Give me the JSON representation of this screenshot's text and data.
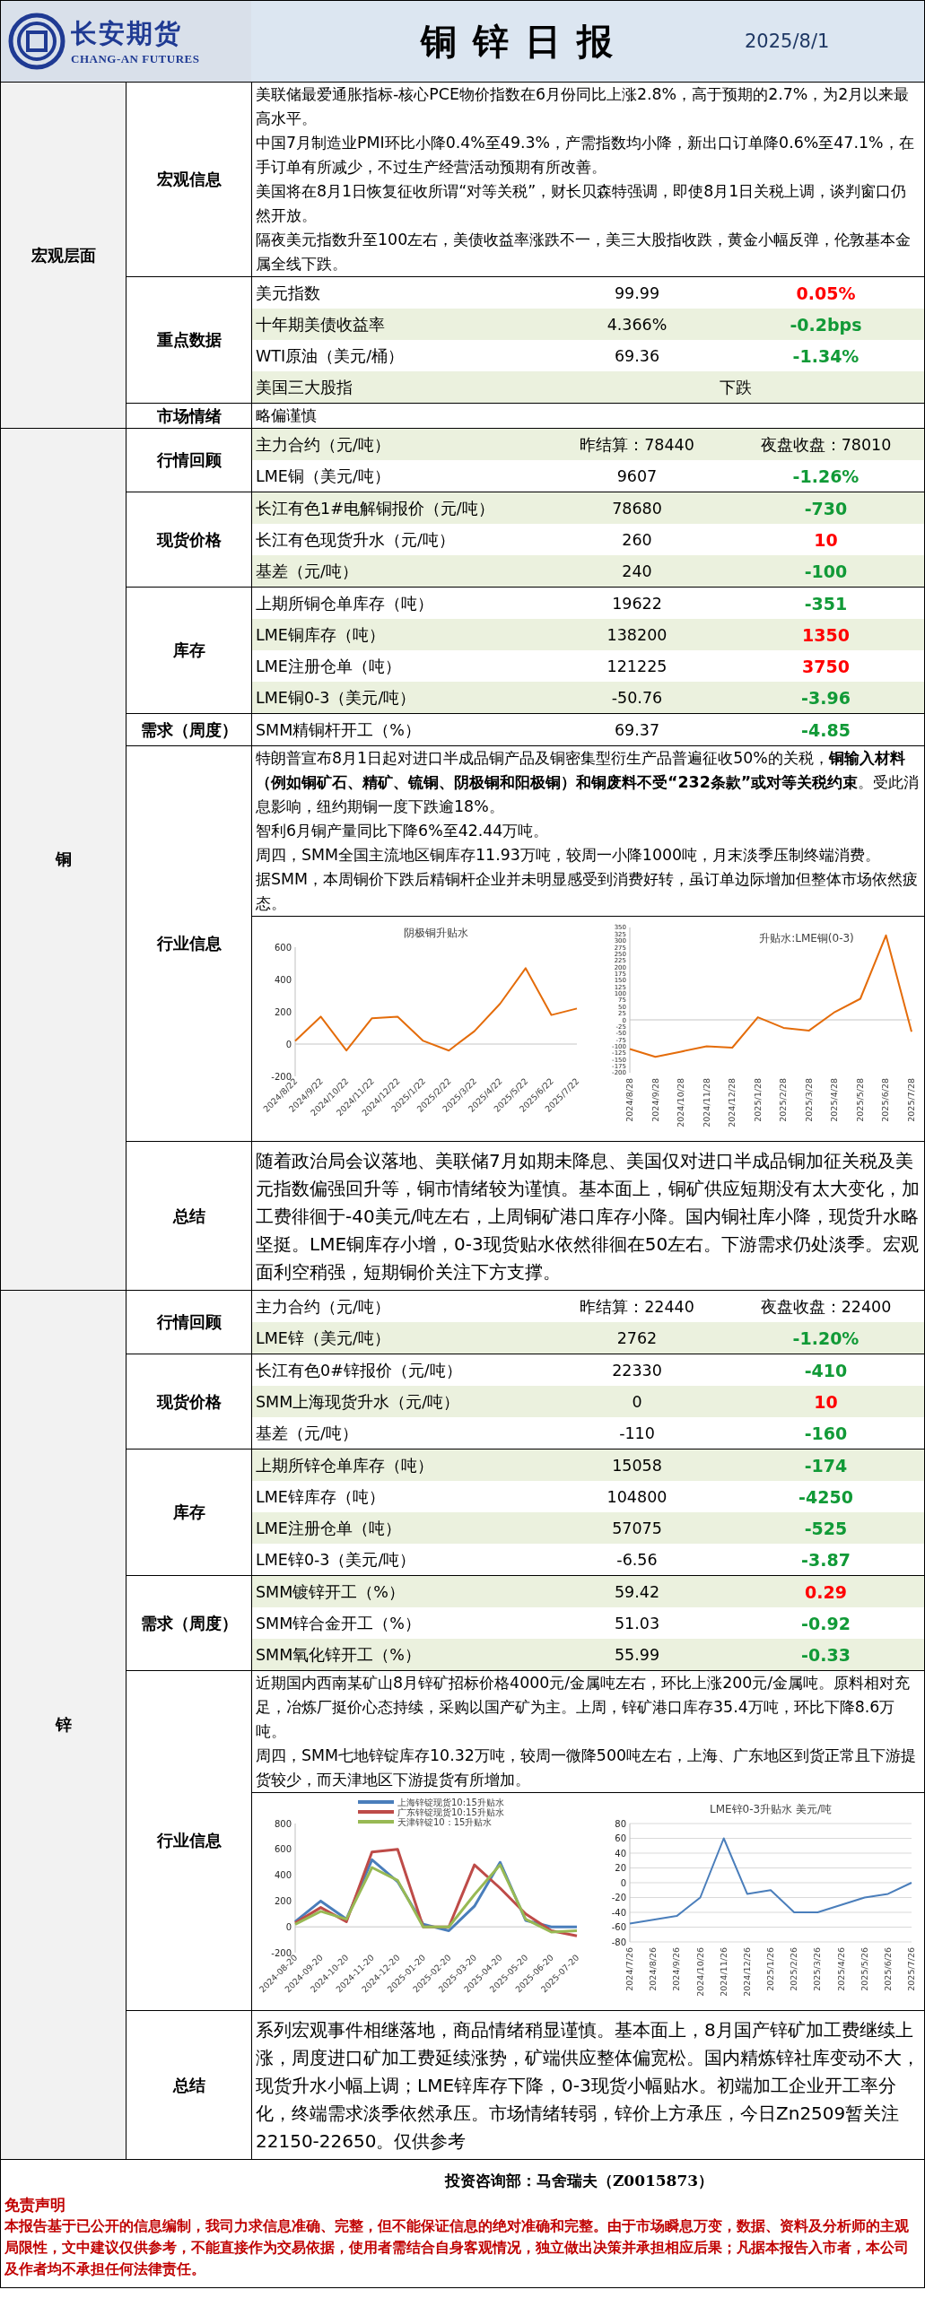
{
  "header": {
    "company": "长安期货",
    "company_en": "CHANG-AN FUTURES",
    "title": "铜锌日报",
    "date": "2025/8/1"
  },
  "sections": [
    {
      "label": "宏观层面",
      "blocks": [
        {
          "label": "宏观信息",
          "kind": "text",
          "paragraphs": [
            "美联储最爱通胀指标-核心PCE物价指数在6月份同比上涨2.8%，高于预期的2.7%，为2月以来最高水平。",
            "中国7月制造业PMI环比小降0.4%至49.3%，产需指数均小降，新出口订单降0.6%至47.1%，在手订单有所减少，不过生产经营活动预期有所改善。",
            "美国将在8月1日恢复征收所谓“对等关税”，财长贝森特强调，即使8月1日关税上调，谈判窗口仍然开放。",
            "隔夜美元指数升至100左右，美债收益率涨跌不一，美三大股指收跌，黄金小幅反弹，伦敦基本金属全线下跌。"
          ]
        },
        {
          "label": "重点数据",
          "kind": "rows",
          "rows": [
            {
              "kind": "quote",
              "label": "美元指数",
              "value": "99.99",
              "change": "0.05%",
              "color": "#ff0000",
              "shaded": false
            },
            {
              "kind": "quote",
              "label": "十年期美债收益率",
              "value": "4.366%",
              "change": "-0.2bps",
              "color": "#119a37",
              "shaded": true
            },
            {
              "kind": "quote",
              "label": "WTI原油（美元/桶）",
              "value": "69.36",
              "change": "-1.34%",
              "color": "#119a37",
              "shaded": false
            },
            {
              "kind": "span",
              "label": "美国三大股指",
              "value": "下跌",
              "shaded": true
            }
          ]
        },
        {
          "label": "市场情绪",
          "kind": "text",
          "paragraphs": [
            "略偏谨慎"
          ]
        }
      ]
    },
    {
      "label": "铜",
      "blocks": [
        {
          "label": "行情回顾",
          "kind": "rows",
          "rows": [
            {
              "kind": "settle",
              "label": "主力合约（元/吨）",
              "prev": "昨结算：78440",
              "night": "夜盘收盘：78010",
              "shaded": true
            },
            {
              "kind": "quote",
              "label": "LME铜（美元/吨）",
              "value": "9607",
              "change": "-1.26%",
              "color": "#119a37",
              "shaded": false
            }
          ]
        },
        {
          "label": "现货价格",
          "kind": "rows",
          "rows": [
            {
              "kind": "quote",
              "label": "长江有色1#电解铜报价（元/吨）",
              "value": "78680",
              "change": "-730",
              "color": "#119a37",
              "shaded": true
            },
            {
              "kind": "quote",
              "label": "长江有色现货升水（元/吨）",
              "value": "260",
              "change": "10",
              "color": "#ff0000",
              "shaded": false
            },
            {
              "kind": "quote",
              "label": "基差（元/吨）",
              "value": "240",
              "change": "-100",
              "color": "#119a37",
              "shaded": true
            }
          ]
        },
        {
          "label": "库存",
          "kind": "rows",
          "rows": [
            {
              "kind": "quote",
              "label": "上期所铜仓单库存（吨）",
              "value": "19622",
              "change": "-351",
              "color": "#119a37",
              "shaded": false
            },
            {
              "kind": "quote",
              "label": "LME铜库存（吨）",
              "value": "138200",
              "change": "1350",
              "color": "#ff0000",
              "shaded": true
            },
            {
              "kind": "quote",
              "label": "LME注册仓单（吨）",
              "value": "121225",
              "change": "3750",
              "color": "#ff0000",
              "shaded": false
            },
            {
              "kind": "quote",
              "label": "LME铜0-3（美元/吨）",
              "value": "-50.76",
              "change": "-3.96",
              "color": "#119a37",
              "shaded": true
            }
          ]
        },
        {
          "label": "需求（周度）",
          "kind": "rows",
          "rows": [
            {
              "kind": "quote",
              "label": "SMM精铜杆开工（%）",
              "value": "69.37",
              "change": "-4.85",
              "color": "#119a37",
              "shaded": false
            }
          ]
        },
        {
          "label": "行业信息",
          "kind": "text",
          "paragraphs": [
            "特朗普宣布8月1日起对进口半成品铜产品及铜密集型衍生产品普遍征收50%的关税，**铜输入材料（例如铜矿石、精矿、锍铜、阴极铜和阳极铜）和铜废料不受“232条款”或对等关税约束**。受此消息影响，纽约期铜一度下跌逾18%。",
            "智利6月铜产量同比下降6%至42.44万吨。",
            "周四，SMM全国主流地区铜库存11.93万吨，较周一小降1000吨，月末淡季压制终端消费。",
            "据SMM，本周铜价下跌后精铜杆企业并未明显感受到消费好转，虽订单边际增加但整体市场依然疲态。"
          ],
          "charts": [
            {
              "chart_data": {
                "type": "line",
                "title": "阴极铜升贴水",
                "series": [
                  {
                    "color": "#e46c0a",
                    "values": [
                      20,
                      170,
                      -40,
                      160,
                      170,
                      20,
                      -40,
                      80,
                      250,
                      470,
                      180,
                      220
                    ]
                  }
                ],
                "ylim": [
                  -200,
                  600
                ],
                "yticks": [
                  -200,
                  0,
                  200,
                  400,
                  600
                ],
                "categories": [
                  "2024/8/22",
                  "2024/9/22",
                  "2024/10/22",
                  "2024/11/22",
                  "2024/12/22",
                  "2025/1/22",
                  "2025/2/22",
                  "2025/3/22",
                  "2025/4/22",
                  "2025/5/22",
                  "2025/6/22",
                  "2025/7/22"
                ]
              }
            },
            {
              "chart_data": {
                "type": "line",
                "title": "升贴水:LME铜(0-3)",
                "series": [
                  {
                    "color": "#e46c0a",
                    "values": [
                      -110,
                      -140,
                      -120,
                      -100,
                      -105,
                      10,
                      -30,
                      -40,
                      30,
                      80,
                      320,
                      -45
                    ]
                  }
                ],
                "ylim": [
                  -200,
                  350
                ],
                "yticks": [
                  -200,
                  -175,
                  -150,
                  -125,
                  -100,
                  -75,
                  -50,
                  -25,
                  0,
                  25,
                  50,
                  75,
                  100,
                  125,
                  150,
                  175,
                  200,
                  225,
                  250,
                  275,
                  300,
                  325,
                  350
                ],
                "categories": [
                  "2024/8/28",
                  "2024/9/28",
                  "2024/10/28",
                  "2024/11/28",
                  "2024/12/28",
                  "2025/1/28",
                  "2025/2/28",
                  "2025/3/28",
                  "2025/4/28",
                  "2025/5/28",
                  "2025/6/28",
                  "2025/7/28"
                ]
              }
            }
          ]
        },
        {
          "label": "总结",
          "kind": "summary",
          "paragraphs": [
            "随着政治局会议落地、美联储7月如期未降息、美国仅对进口半成品铜加征关税及美元指数偏强回升等，铜市情绪较为谨慎。基本面上，铜矿供应短期没有太大变化，加工费徘徊于-40美元/吨左右，上周铜矿港口库存小降。国内铜社库小降，现货升水略坚挺。LME铜库存小增，0-3现货贴水依然徘徊在50左右。下游需求仍处淡季。宏观面利空稍强，短期铜价关注下方支撑。"
          ]
        }
      ]
    },
    {
      "label": "锌",
      "blocks": [
        {
          "label": "行情回顾",
          "kind": "rows",
          "rows": [
            {
              "kind": "settle",
              "label": "主力合约（元/吨）",
              "prev": "昨结算：22440",
              "night": "夜盘收盘：22400",
              "shaded": false
            },
            {
              "kind": "quote",
              "label": "LME锌（美元/吨）",
              "value": "2762",
              "change": "-1.20%",
              "color": "#119a37",
              "shaded": true
            }
          ]
        },
        {
          "label": "现货价格",
          "kind": "rows",
          "rows": [
            {
              "kind": "quote",
              "label": "长江有色0#锌报价（元/吨）",
              "value": "22330",
              "change": "-410",
              "color": "#119a37",
              "shaded": false
            },
            {
              "kind": "quote",
              "label": "SMM上海现货升水（元/吨）",
              "value": "0",
              "change": "10",
              "color": "#ff0000",
              "shaded": true
            },
            {
              "kind": "quote",
              "label": "基差（元/吨）",
              "value": "-110",
              "change": "-160",
              "color": "#119a37",
              "shaded": false
            }
          ]
        },
        {
          "label": "库存",
          "kind": "rows",
          "rows": [
            {
              "kind": "quote",
              "label": "上期所锌仓单库存（吨）",
              "value": "15058",
              "change": "-174",
              "color": "#119a37",
              "shaded": true
            },
            {
              "kind": "quote",
              "label": "LME锌库存（吨）",
              "value": "104800",
              "change": "-4250",
              "color": "#119a37",
              "shaded": false
            },
            {
              "kind": "quote",
              "label": "LME注册仓单（吨）",
              "value": "57075",
              "change": "-525",
              "color": "#119a37",
              "shaded": true
            },
            {
              "kind": "quote",
              "label": "LME锌0-3（美元/吨）",
              "value": "-6.56",
              "change": "-3.87",
              "color": "#119a37",
              "shaded": false
            }
          ]
        },
        {
          "label": "需求（周度）",
          "kind": "rows",
          "rows": [
            {
              "kind": "quote",
              "label": "SMM镀锌开工（%）",
              "value": "59.42",
              "change": "0.29",
              "color": "#ff0000",
              "shaded": true
            },
            {
              "kind": "quote",
              "label": "SMM锌合金开工（%）",
              "value": "51.03",
              "change": "-0.92",
              "color": "#119a37",
              "shaded": false
            },
            {
              "kind": "quote",
              "label": "SMM氧化锌开工（%）",
              "value": "55.99",
              "change": "-0.33",
              "color": "#119a37",
              "shaded": true
            }
          ]
        },
        {
          "label": "行业信息",
          "kind": "text",
          "paragraphs": [
            "近期国内西南某矿山8月锌矿招标价格4000元/金属吨左右，环比上涨200元/金属吨。原料相对充足，冶炼厂挺价心态持续，采购以国产矿为主。上周，锌矿港口库存35.4万吨，环比下降8.6万吨。",
            "周四，SMM七地锌锭库存10.32万吨，较周一微降500吨左右，上海、广东地区到货正常且下游提货较少，而天津地区下游提货有所增加。"
          ],
          "charts": [
            {
              "chart_data": {
                "type": "line",
                "legend": "top",
                "series": [
                  {
                    "name": "上海锌锭现货10:15升贴水",
                    "color": "#4a7ebb",
                    "values": [
                      40,
                      200,
                      60,
                      520,
                      350,
                      20,
                      -30,
                      160,
                      500,
                      50,
                      0,
                      0
                    ]
                  },
                  {
                    "name": "广东锌锭现货10:15升贴水",
                    "color": "#be4b48",
                    "values": [
                      30,
                      150,
                      40,
                      580,
                      600,
                      0,
                      0,
                      480,
                      300,
                      100,
                      -30,
                      -70
                    ]
                  },
                  {
                    "name": "天津锌锭10：15升贴水",
                    "color": "#98b954",
                    "values": [
                      20,
                      120,
                      60,
                      460,
                      360,
                      0,
                      0,
                      250,
                      480,
                      60,
                      -40,
                      -30
                    ]
                  }
                ],
                "ylim": [
                  -200,
                  800
                ],
                "yticks": [
                  -200,
                  0,
                  200,
                  400,
                  600,
                  800
                ],
                "categories": [
                  "2024-08-20",
                  "2024-09-20",
                  "2024-10-20",
                  "2024-11-20",
                  "2024-12-20",
                  "2025-01-20",
                  "2025-02-20",
                  "2025-03-20",
                  "2025-04-20",
                  "2025-05-20",
                  "2025-06-20",
                  "2025-07-20"
                ]
              }
            },
            {
              "chart_data": {
                "type": "line",
                "title": "LME锌0-3升贴水 美元/吨",
                "grid": true,
                "series": [
                  {
                    "color": "#4a7ebb",
                    "values": [
                      -55,
                      -50,
                      -45,
                      -20,
                      60,
                      -15,
                      -10,
                      -40,
                      -40,
                      -30,
                      -20,
                      -15,
                      0
                    ]
                  }
                ],
                "ylim": [
                  -80,
                  80
                ],
                "yticks": [
                  -80,
                  -60,
                  -40,
                  -20,
                  0,
                  20,
                  40,
                  60,
                  80
                ],
                "categories": [
                  "2024/7/26",
                  "2024/8/26",
                  "2024/9/26",
                  "2024/10/26",
                  "2024/11/26",
                  "2024/12/26",
                  "2025/1/26",
                  "2025/2/26",
                  "2025/3/26",
                  "2025/4/26",
                  "2025/5/26",
                  "2025/6/26",
                  "2025/7/26"
                ]
              }
            }
          ]
        },
        {
          "label": "总结",
          "kind": "summary",
          "paragraphs": [
            "系列宏观事件相继落地，商品情绪稍显谨慎。基本面上，8月国产锌矿加工费继续上涨，周度进口矿加工费延续涨势，矿端供应整体偏宽松。国内精炼锌社库变动不大，现货升水小幅上调；LME锌库存下降，0-3现货小幅贴水。初端加工企业开工率分化，终端需求淡季依然承压。市场情绪转弱，锌价上方承压，今日Zn2509暂关注22150-22650。仅供参考"
          ]
        }
      ]
    }
  ],
  "footer": {
    "contact": "投资咨询部：马舍瑞夫（Z0015873）",
    "disclaimer_title": "免责声明",
    "disclaimer": "本报告基于已公开的信息编制，我司力求信息准确、完整，但不能保证信息的绝对准确和完整。由于市场瞬息万变，数据、资料及分析师的主观局限性，文中建议仅供参考，不能直接作为交易依据，使用者需结合自身客观情况，独立做出决策并承担相应后果；凡据本报告入市者，本公司及作者均不承担任何法律责任。"
  }
}
